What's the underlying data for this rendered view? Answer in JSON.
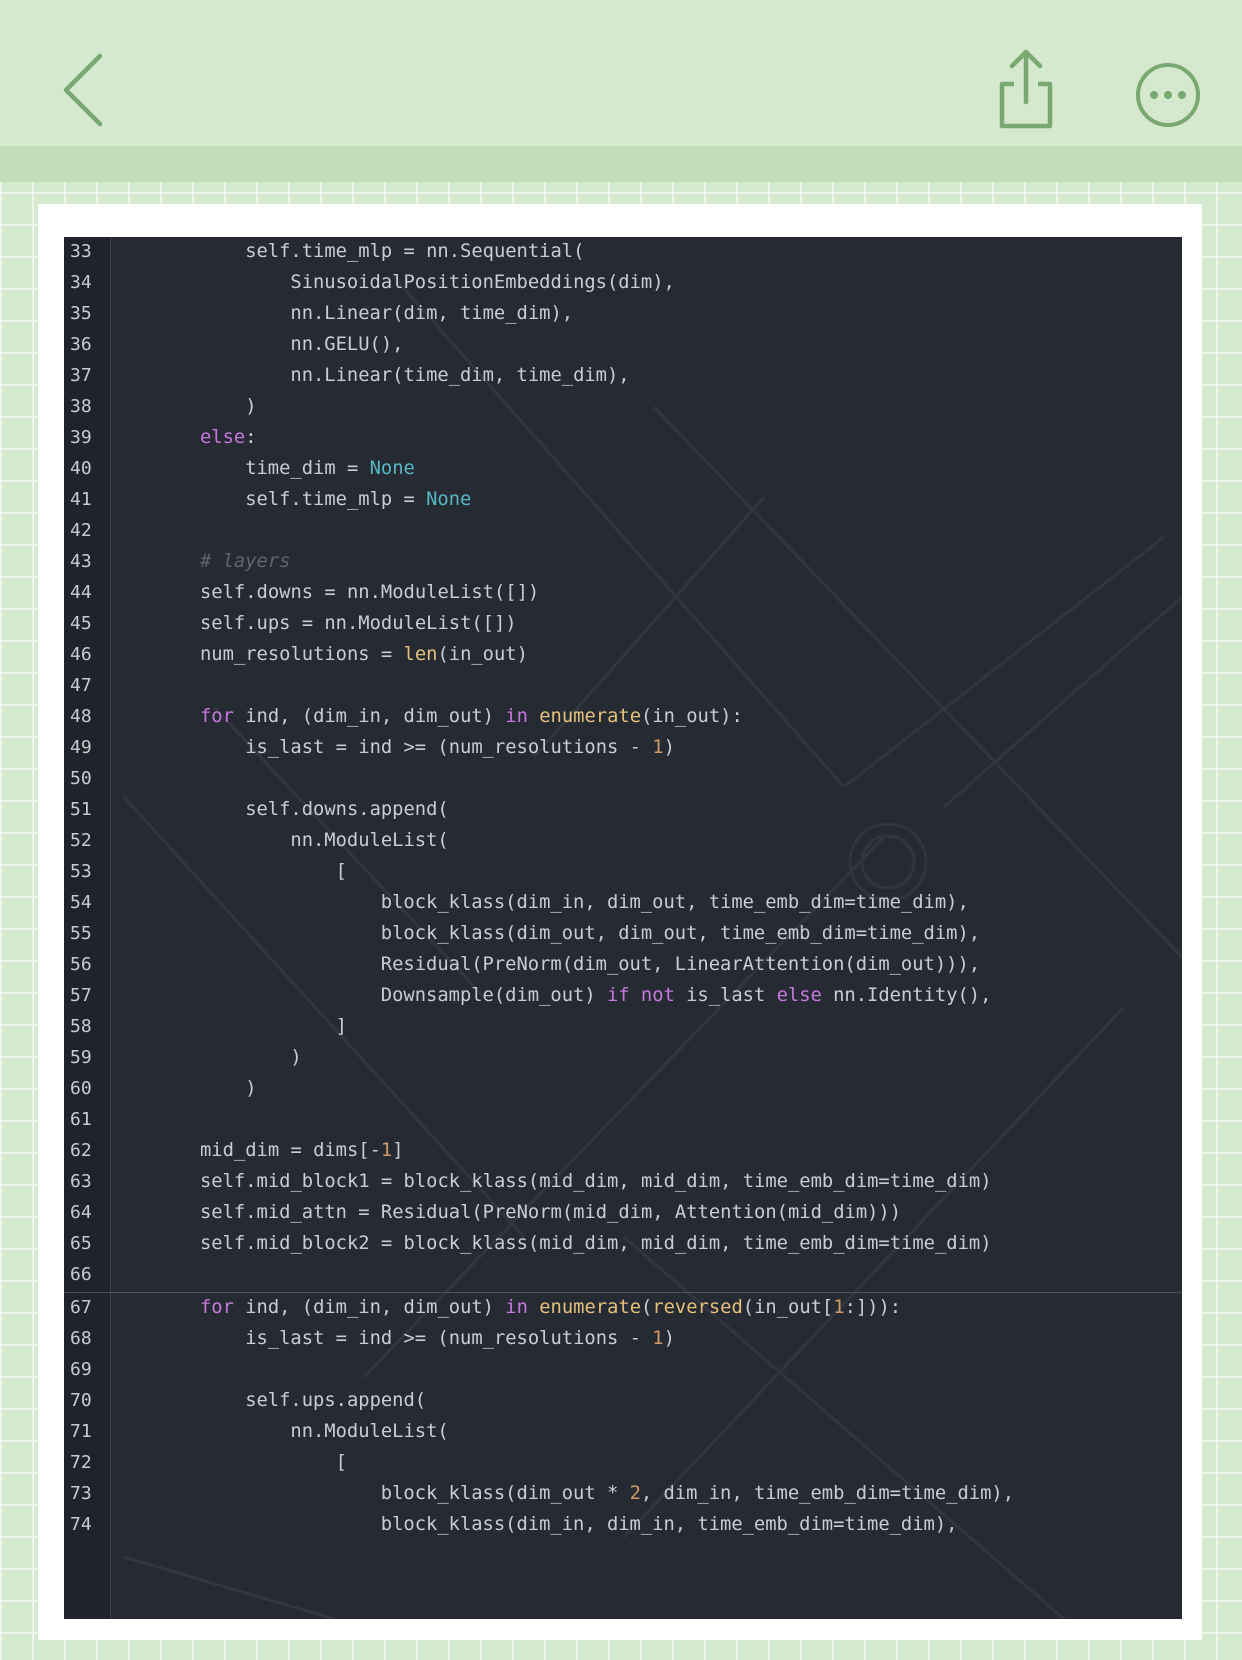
{
  "toolbar": {
    "back_icon": "chevron-left-icon",
    "share_icon": "share-icon",
    "more_icon": "more-horizontal-icon",
    "icon_color": "#7aa872"
  },
  "code": {
    "theme": {
      "background": "#262b33",
      "gutter": "#20242a",
      "text": "#c8cdd4",
      "keyword": "#c679dd",
      "builtin": "#e5c07b",
      "constant": "#56b6c2",
      "number": "#d19a66",
      "comment": "#5c6470"
    },
    "lines": [
      {
        "n": "33",
        "indent": 3,
        "tokens": [
          [
            "self.time_mlp = nn.Sequential(",
            ""
          ]
        ]
      },
      {
        "n": "34",
        "indent": 4,
        "tokens": [
          [
            "SinusoidalPositionEmbeddings(dim),",
            ""
          ]
        ]
      },
      {
        "n": "35",
        "indent": 4,
        "tokens": [
          [
            "nn.Linear(dim, time_dim),",
            ""
          ]
        ]
      },
      {
        "n": "36",
        "indent": 4,
        "tokens": [
          [
            "nn.GELU(),",
            ""
          ]
        ]
      },
      {
        "n": "37",
        "indent": 4,
        "tokens": [
          [
            "nn.Linear(time_dim, time_dim),",
            ""
          ]
        ]
      },
      {
        "n": "38",
        "indent": 3,
        "tokens": [
          [
            ")",
            ""
          ]
        ]
      },
      {
        "n": "39",
        "indent": 2,
        "tokens": [
          [
            "else",
            "kw"
          ],
          [
            ":",
            ""
          ]
        ]
      },
      {
        "n": "40",
        "indent": 3,
        "tokens": [
          [
            "time_dim = ",
            ""
          ],
          [
            "None",
            "nn"
          ]
        ]
      },
      {
        "n": "41",
        "indent": 3,
        "tokens": [
          [
            "self.time_mlp = ",
            ""
          ],
          [
            "None",
            "nn"
          ]
        ]
      },
      {
        "n": "42",
        "indent": 0,
        "tokens": []
      },
      {
        "n": "43",
        "indent": 2,
        "tokens": [
          [
            "# layers",
            "cm"
          ]
        ]
      },
      {
        "n": "44",
        "indent": 2,
        "tokens": [
          [
            "self.downs = nn.ModuleList([])",
            ""
          ]
        ]
      },
      {
        "n": "45",
        "indent": 2,
        "tokens": [
          [
            "self.ups = nn.ModuleList([])",
            ""
          ]
        ]
      },
      {
        "n": "46",
        "indent": 2,
        "tokens": [
          [
            "num_resolutions = ",
            ""
          ],
          [
            "len",
            "bi"
          ],
          [
            "(in_out)",
            ""
          ]
        ]
      },
      {
        "n": "47",
        "indent": 0,
        "tokens": []
      },
      {
        "n": "48",
        "indent": 2,
        "tokens": [
          [
            "for",
            "kw"
          ],
          [
            " ind, (dim_in, dim_out) ",
            ""
          ],
          [
            "in",
            "kw"
          ],
          [
            " ",
            ""
          ],
          [
            "enumerate",
            "bi"
          ],
          [
            "(in_out):",
            ""
          ]
        ]
      },
      {
        "n": "49",
        "indent": 3,
        "tokens": [
          [
            "is_last = ind >= (num_resolutions - ",
            ""
          ],
          [
            "1",
            "nm"
          ],
          [
            ")",
            ""
          ]
        ]
      },
      {
        "n": "50",
        "indent": 0,
        "tokens": []
      },
      {
        "n": "51",
        "indent": 3,
        "tokens": [
          [
            "self.downs.append(",
            ""
          ]
        ]
      },
      {
        "n": "52",
        "indent": 4,
        "tokens": [
          [
            "nn.ModuleList(",
            ""
          ]
        ]
      },
      {
        "n": "53",
        "indent": 5,
        "tokens": [
          [
            "[",
            ""
          ]
        ]
      },
      {
        "n": "54",
        "indent": 6,
        "tokens": [
          [
            "block_klass(dim_in, dim_out, time_emb_dim=time_dim),",
            ""
          ]
        ]
      },
      {
        "n": "55",
        "indent": 6,
        "tokens": [
          [
            "block_klass(dim_out, dim_out, time_emb_dim=time_dim),",
            ""
          ]
        ]
      },
      {
        "n": "56",
        "indent": 6,
        "tokens": [
          [
            "Residual(PreNorm(dim_out, LinearAttention(dim_out))),",
            ""
          ]
        ]
      },
      {
        "n": "57",
        "indent": 6,
        "tokens": [
          [
            "Downsample(dim_out) ",
            ""
          ],
          [
            "if",
            "kw"
          ],
          [
            " ",
            ""
          ],
          [
            "not",
            "kw"
          ],
          [
            " is_last ",
            ""
          ],
          [
            "else",
            "kw"
          ],
          [
            " nn.Identity(),",
            ""
          ]
        ]
      },
      {
        "n": "58",
        "indent": 5,
        "tokens": [
          [
            "]",
            ""
          ]
        ]
      },
      {
        "n": "59",
        "indent": 4,
        "tokens": [
          [
            ")",
            ""
          ]
        ]
      },
      {
        "n": "60",
        "indent": 3,
        "tokens": [
          [
            ")",
            ""
          ]
        ]
      },
      {
        "n": "61",
        "indent": 0,
        "tokens": []
      },
      {
        "n": "62",
        "indent": 2,
        "tokens": [
          [
            "mid_dim = dims[-",
            ""
          ],
          [
            "1",
            "nm"
          ],
          [
            "]",
            ""
          ]
        ]
      },
      {
        "n": "63",
        "indent": 2,
        "tokens": [
          [
            "self.mid_block1 = block_klass(mid_dim, mid_dim, time_emb_dim=time_dim)",
            ""
          ]
        ]
      },
      {
        "n": "64",
        "indent": 2,
        "tokens": [
          [
            "self.mid_attn = Residual(PreNorm(mid_dim, Attention(mid_dim)))",
            ""
          ]
        ]
      },
      {
        "n": "65",
        "indent": 2,
        "tokens": [
          [
            "self.mid_block2 = block_klass(mid_dim, mid_dim, time_emb_dim=time_dim)",
            ""
          ]
        ]
      },
      {
        "n": "66",
        "indent": 0,
        "tokens": []
      },
      {
        "n": "67",
        "indent": 2,
        "tokens": [
          [
            "for",
            "kw"
          ],
          [
            " ind, (dim_in, dim_out) ",
            ""
          ],
          [
            "in",
            "kw"
          ],
          [
            " ",
            ""
          ],
          [
            "enumerate",
            "bi"
          ],
          [
            "(",
            ""
          ],
          [
            "reversed",
            "bi"
          ],
          [
            "(in_out[",
            ""
          ],
          [
            "1",
            "nm"
          ],
          [
            ":])):",
            ""
          ]
        ]
      },
      {
        "n": "68",
        "indent": 3,
        "tokens": [
          [
            "is_last = ind >= (num_resolutions - ",
            ""
          ],
          [
            "1",
            "nm"
          ],
          [
            ")",
            ""
          ]
        ]
      },
      {
        "n": "69",
        "indent": 0,
        "tokens": []
      },
      {
        "n": "70",
        "indent": 3,
        "tokens": [
          [
            "self.ups.append(",
            ""
          ]
        ]
      },
      {
        "n": "71",
        "indent": 4,
        "tokens": [
          [
            "nn.ModuleList(",
            ""
          ]
        ]
      },
      {
        "n": "72",
        "indent": 5,
        "tokens": [
          [
            "[",
            ""
          ]
        ]
      },
      {
        "n": "73",
        "indent": 6,
        "tokens": [
          [
            "block_klass(dim_out * ",
            ""
          ],
          [
            "2",
            "nm"
          ],
          [
            ", dim_in, time_emb_dim=time_dim),",
            ""
          ]
        ]
      },
      {
        "n": "74",
        "indent": 6,
        "tokens": [
          [
            "block_klass(dim_in, dim_in, time_emb_dim=time_dim),",
            ""
          ]
        ]
      }
    ]
  }
}
